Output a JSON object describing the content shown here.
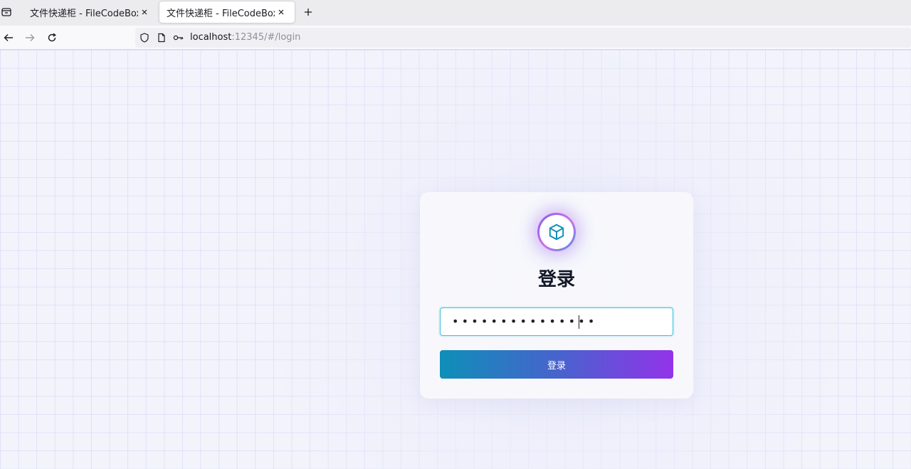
{
  "browser": {
    "tabs": [
      {
        "title": "文件快递柜 - FileCodeBox",
        "active": false
      },
      {
        "title": "文件快递柜 - FileCodeBox",
        "active": true
      }
    ],
    "url_host": "localhost",
    "url_path": ":12345/#/login"
  },
  "icons": {
    "tab_list": "tab-list-icon",
    "close": "close-icon",
    "new_tab": "plus-icon",
    "back": "arrow-left-icon",
    "forward": "arrow-right-icon",
    "reload": "reload-icon",
    "shield": "shield-icon",
    "page": "page-icon",
    "key": "key-icon",
    "logo": "cube-icon"
  },
  "login": {
    "title": "登录",
    "password_mask": "•••••••••••••••",
    "button_label": "登录"
  },
  "colors": {
    "accent_start": "#0e8fb8",
    "accent_end": "#9333ea",
    "input_focus": "#3cc1dc"
  }
}
